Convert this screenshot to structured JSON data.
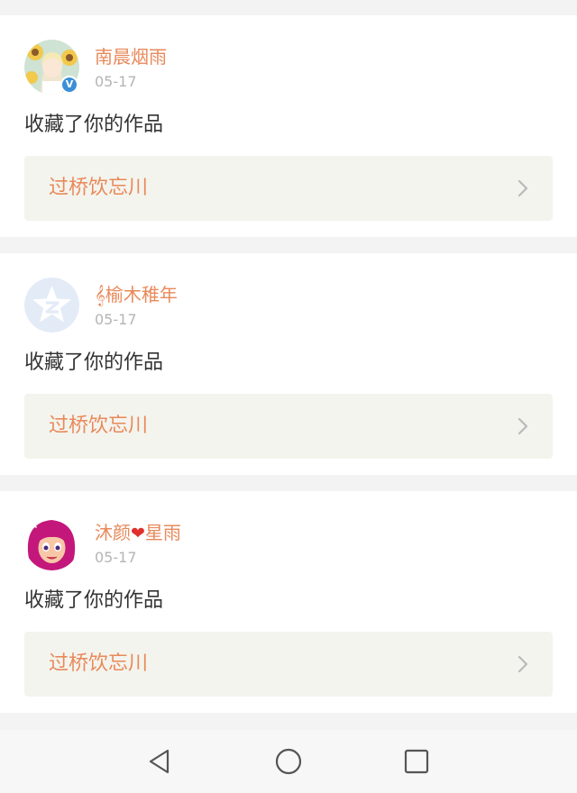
{
  "notifications": [
    {
      "username": "南晨烟雨",
      "date": "05-17",
      "action": "收藏了你的作品",
      "work_title": "过桥饮忘川",
      "verified_badge": "V",
      "avatar_icon": "anime-girl-sunflower-avatar"
    },
    {
      "username": "𝄞榆木稚年",
      "date": "05-17",
      "action": "收藏了你的作品",
      "work_title": "过桥饮忘川",
      "avatar_icon": "qzone-star-avatar"
    },
    {
      "username_part1": "沐颜",
      "username_part2": "星雨",
      "heart": "❤",
      "date": "05-17",
      "action": "收藏了你的作品",
      "work_title": "过桥饮忘川",
      "avatar_icon": "cartoon-pink-hair-avatar"
    }
  ],
  "colors": {
    "accent": "#e8895a",
    "link_bg": "#f4f4ee",
    "page_bg": "#f3f3f3",
    "verified": "#3b8fd6"
  },
  "navbar": {
    "icons": [
      "back-triangle-icon",
      "home-circle-icon",
      "recents-square-icon"
    ]
  }
}
